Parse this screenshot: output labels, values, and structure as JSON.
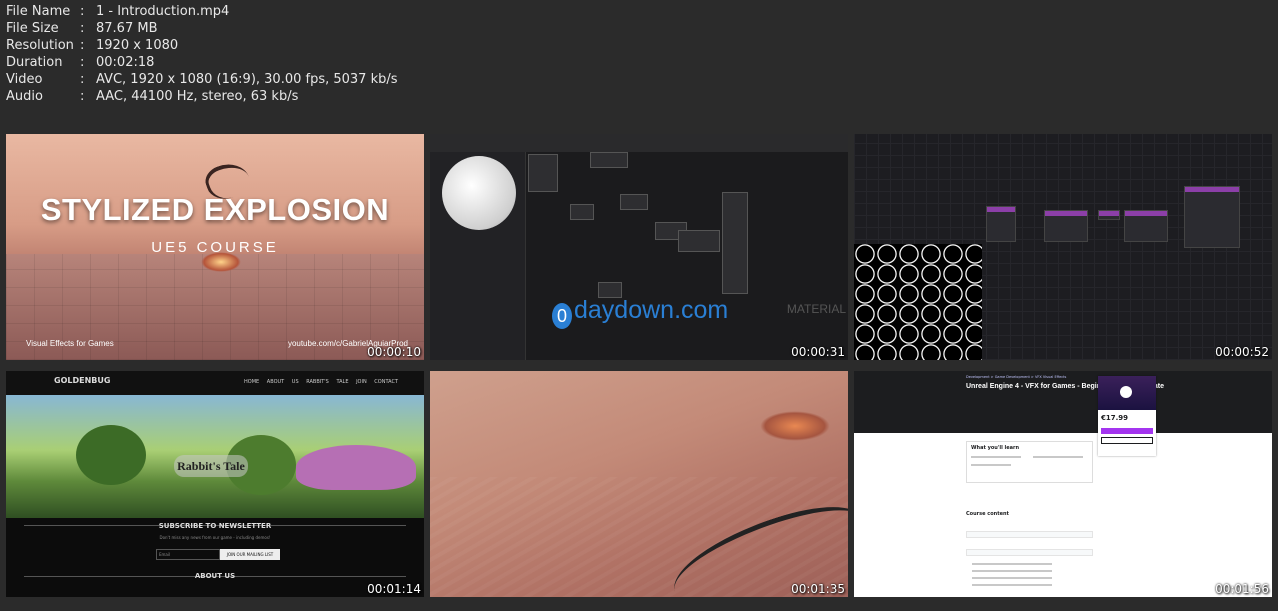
{
  "file_info": [
    {
      "key": "File Name",
      "value": "1 - Introduction.mp4"
    },
    {
      "key": "File Size",
      "value": "87.67 MB"
    },
    {
      "key": "Resolution",
      "value": "1920 x 1080"
    },
    {
      "key": "Duration",
      "value": "00:02:18"
    },
    {
      "key": "Video",
      "value": "AVC, 1920 x 1080 (16:9), 30.00 fps, 5037 kb/s"
    },
    {
      "key": "Audio",
      "value": "AAC, 44100 Hz, stereo, 63 kb/s"
    }
  ],
  "separator": ":",
  "thumbnails": [
    {
      "timestamp": "00:00:10",
      "title": "STYLIZED EXPLOSION",
      "subtitle": "UE5 COURSE",
      "caption_left": "Visual Effects for Games",
      "caption_right": "youtube.com/c/GabrielAguiarProd"
    },
    {
      "timestamp": "00:00:31",
      "watermark": "daydown.com",
      "watermark_icon": "0",
      "label": "MATERIAL"
    },
    {
      "timestamp": "00:00:52"
    },
    {
      "timestamp": "00:01:14",
      "logo": "GOLDENBUG",
      "menu": "HOME ABOUT US RABBIT'S TALE JOIN CONTACT",
      "hero_title": "Rabbit's Tale",
      "newsletter_heading": "SUBSCRIBE TO NEWSLETTER",
      "newsletter_note": "Don't miss any news from our game - including demos!",
      "email_placeholder": "Email",
      "subscribe_button": "JOIN OUR MAILING LIST",
      "about_heading": "ABOUT US"
    },
    {
      "timestamp": "00:01:35"
    },
    {
      "timestamp": "00:01:56",
      "breadcrumb": "Development > Game Development > VFX Visual Effects",
      "course_title": "Unreal Engine 4 - VFX for Games - Beginner to Intermediate",
      "price": "€17.99",
      "section_learn": "What you'll learn",
      "section_content": "Course content"
    }
  ]
}
